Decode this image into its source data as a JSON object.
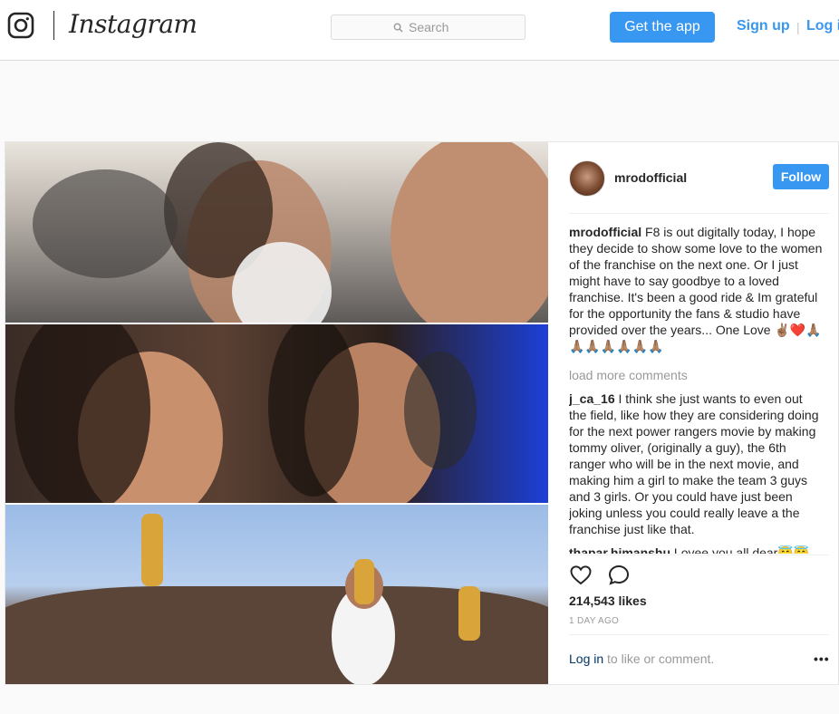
{
  "header": {
    "brand": "Instagram",
    "search_placeholder": "Search",
    "get_app_label": "Get the app",
    "signup_label": "Sign up",
    "separator": "|",
    "login_label": "Log in"
  },
  "post": {
    "author": "mrodofficial",
    "follow_label": "Follow",
    "caption": {
      "user": "mrodofficial",
      "text": "F8 is out digitally today, I hope they decide to show some love to the women of the franchise on the next one. Or I just might have to say goodbye to a loved franchise. It's been a good ride & Im grateful for the opportunity the fans & studio have provided over the years... One Love ✌🏽❤️🙏🏽🙏🏽🙏🏽🙏🏽🙏🏽🙏🏽🙏🏽"
    },
    "load_more_label": "load more comments",
    "comments": [
      {
        "user": "j_ca_16",
        "text": "I think she just wants to even out the field, like how they are considering doing for the next power rangers movie by making tommy oliver, (originally a guy), the 6th ranger who will be in the next movie, and making him a girl to make the team 3 guys and 3 girls. Or you could have just been joking unless you could really leave a the franchise just like that."
      },
      {
        "user": "thapar.himanshu",
        "text": "Lovee you all dear😇😇"
      }
    ],
    "likes": "214,543 likes",
    "date": "1 DAY AGO",
    "login_link": "Log in",
    "login_suffix": " to like or comment.",
    "more_label": "•••"
  },
  "colors": {
    "accent": "#3897f0",
    "muted": "#999999",
    "border": "#dbdbdb"
  },
  "icons": [
    "instagram-glyph-icon",
    "search-icon",
    "heart-icon",
    "comment-icon",
    "more-options-icon"
  ]
}
